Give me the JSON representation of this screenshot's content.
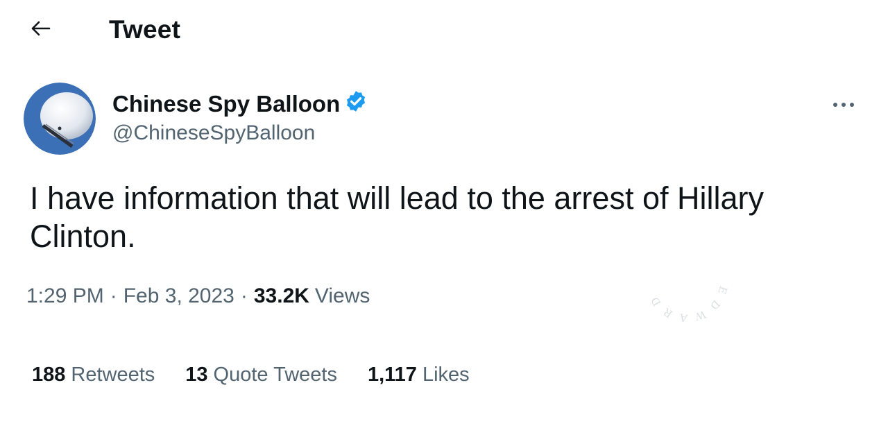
{
  "header": {
    "back_icon": "arrow-left-icon",
    "title": "Tweet"
  },
  "author": {
    "avatar_icon": "balloon-avatar",
    "display_name": "Chinese Spy Balloon",
    "verified_icon": "verified-badge-icon",
    "handle": "@ChineseSpyBalloon",
    "more_icon": "more-horizontal-icon"
  },
  "tweet": {
    "text": "I have information that will lead to the arrest of Hillary Clinton."
  },
  "meta": {
    "time": "1:29 PM",
    "separator": "·",
    "date": "Feb 3, 2023",
    "views_count": "33.2K",
    "views_label": "Views"
  },
  "stats": {
    "retweets_count": "188",
    "retweets_label": "Retweets",
    "quotes_count": "13",
    "quotes_label": "Quote Tweets",
    "likes_count": "1,117",
    "likes_label": "Likes"
  },
  "watermark": {
    "text": "EDWARD SNOWDEN"
  },
  "colors": {
    "text_primary": "#0f1419",
    "text_secondary": "#536471",
    "verified_blue": "#1d9bf0",
    "avatar_ring": "#3b6fb6",
    "background": "#ffffff"
  }
}
